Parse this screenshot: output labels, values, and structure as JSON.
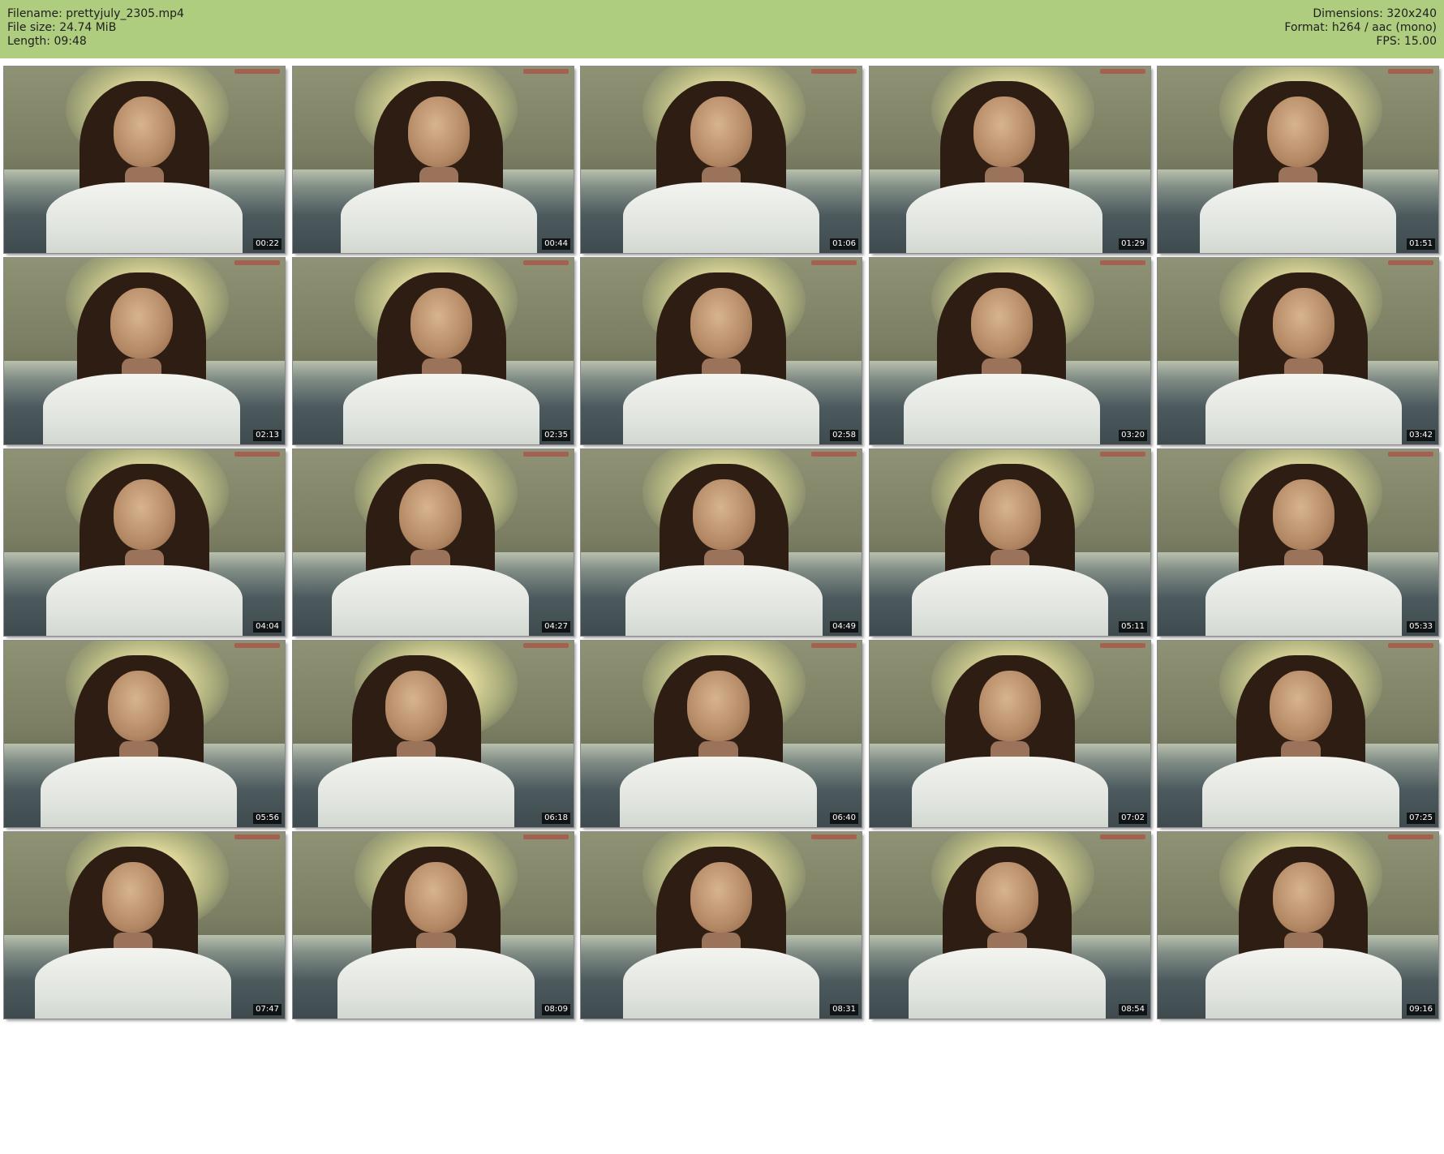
{
  "header": {
    "filename_line": "Filename: prettyjuly_2305.mp4",
    "filesize_line": "File size: 24.74 MiB",
    "length_line": "Length: 09:48",
    "dimensions_line": "Dimensions: 320x240",
    "format_line": "Format: h264 / aac (mono)",
    "fps_line": "FPS: 15.00",
    "background_color": "#afcd7f"
  },
  "thumbnails": [
    {
      "time": "00:22"
    },
    {
      "time": "00:44"
    },
    {
      "time": "01:06"
    },
    {
      "time": "01:29"
    },
    {
      "time": "01:51"
    },
    {
      "time": "02:13"
    },
    {
      "time": "02:35"
    },
    {
      "time": "02:58"
    },
    {
      "time": "03:20"
    },
    {
      "time": "03:42"
    },
    {
      "time": "04:04"
    },
    {
      "time": "04:27"
    },
    {
      "time": "04:49"
    },
    {
      "time": "05:11"
    },
    {
      "time": "05:33"
    },
    {
      "time": "05:56"
    },
    {
      "time": "06:18"
    },
    {
      "time": "06:40"
    },
    {
      "time": "07:02"
    },
    {
      "time": "07:25"
    },
    {
      "time": "07:47"
    },
    {
      "time": "08:09"
    },
    {
      "time": "08:31"
    },
    {
      "time": "08:54"
    },
    {
      "time": "09:16"
    }
  ]
}
